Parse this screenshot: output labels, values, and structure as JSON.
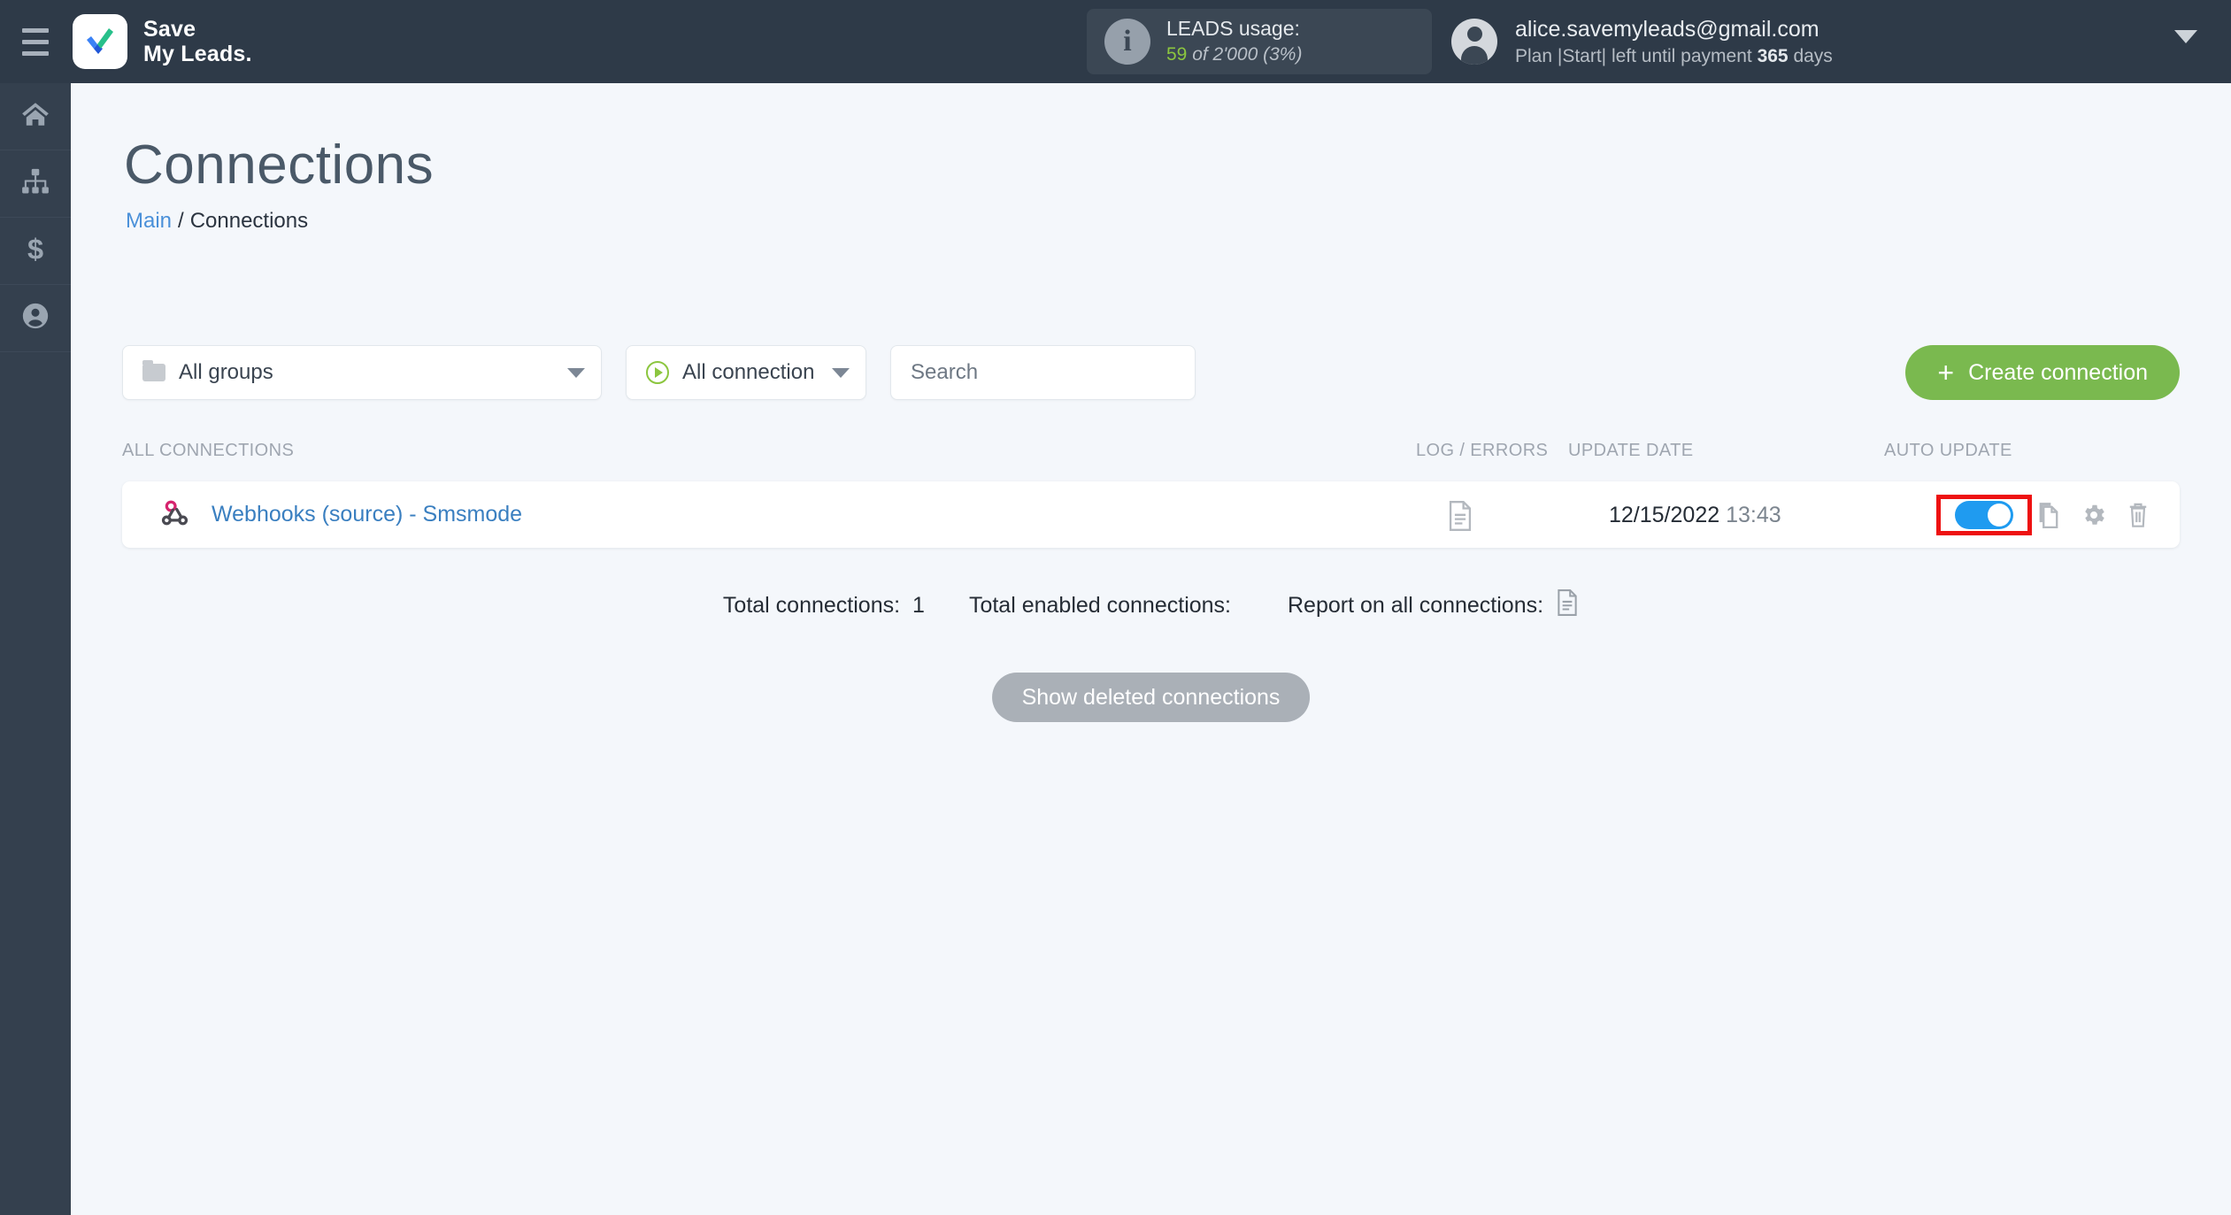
{
  "topbar": {
    "menu_icon": "hamburger-icon",
    "brand_line1": "Save",
    "brand_line2": "My Leads.",
    "leads": {
      "info_icon": "info-icon",
      "title": "LEADS usage:",
      "used": "59",
      "of": "of 2'000",
      "percent": "(3%)"
    },
    "account": {
      "avatar_icon": "user-avatar-icon",
      "email": "alice.savemyleads@gmail.com",
      "plan_prefix": "Plan |Start| left until payment",
      "plan_days": "365",
      "plan_suffix": "days",
      "chevron_icon": "chevron-down-icon"
    }
  },
  "sidebar": {
    "items": [
      {
        "name": "home",
        "icon": "home-icon"
      },
      {
        "name": "connections",
        "icon": "sitemap-icon"
      },
      {
        "name": "billing",
        "icon": "dollar-icon"
      },
      {
        "name": "account",
        "icon": "user-circle-icon"
      }
    ]
  },
  "page": {
    "title": "Connections",
    "breadcrumb": {
      "root": "Main",
      "separator": "/",
      "current": "Connections"
    }
  },
  "filters": {
    "group_select": {
      "value": "All groups",
      "icon": "folder-icon"
    },
    "connection_select": {
      "value": "All connection",
      "icon": "play-circle-icon"
    },
    "search": {
      "value": "",
      "placeholder": "Search"
    },
    "create_button": {
      "label": "Create connection",
      "plus": "+",
      "color": "#7ab94f"
    }
  },
  "table": {
    "headers": {
      "all_connections": "ALL CONNECTIONS",
      "log_errors": "LOG / ERRORS",
      "update_date": "UPDATE DATE",
      "auto_update": "AUTO UPDATE"
    },
    "rows": [
      {
        "icon": "webhook-icon",
        "name": "Webhooks (source) - Smsmode",
        "log_icon": "document-icon",
        "date": "12/15/2022",
        "time": "13:43",
        "auto_update_on": true,
        "actions": [
          "copy-icon",
          "gear-icon",
          "trash-icon"
        ]
      }
    ]
  },
  "totals": {
    "total_connections_label": "Total connections:",
    "total_connections_value": "1",
    "total_enabled_label": "Total enabled connections:",
    "total_enabled_value": "",
    "report_label": "Report on all connections:",
    "report_icon": "document-icon"
  },
  "footer": {
    "show_deleted_button": "Show deleted connections"
  },
  "highlight": {
    "target": "auto-update-toggle",
    "color": "#ee1111"
  }
}
